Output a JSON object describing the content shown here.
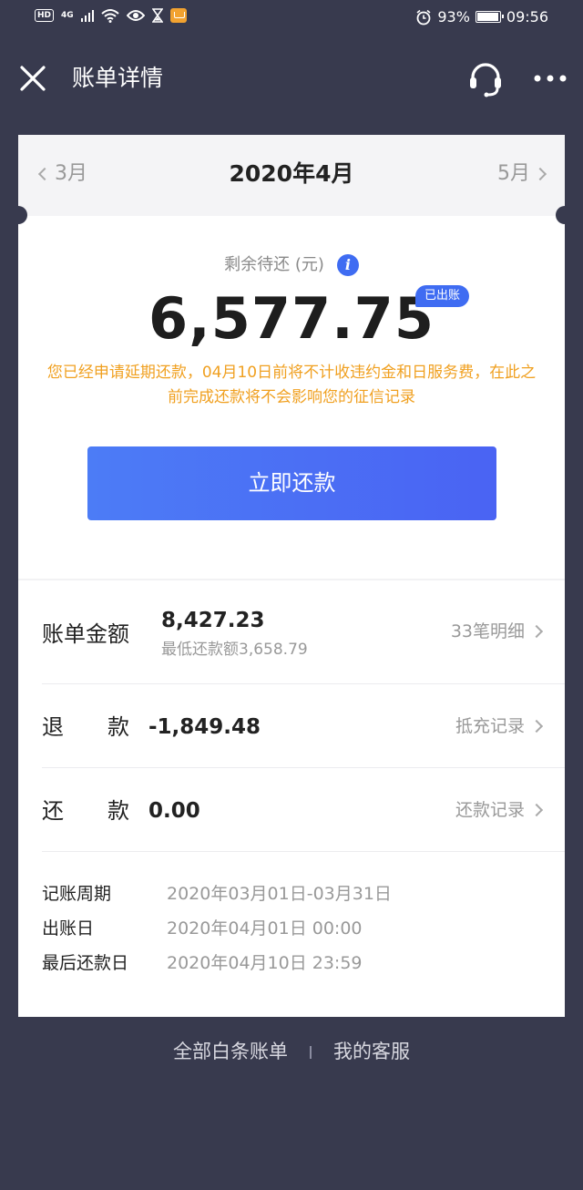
{
  "status_bar": {
    "hd": "HD",
    "network": "4G",
    "battery_percent": "93%",
    "time": "09:56"
  },
  "nav": {
    "title": "账单详情"
  },
  "month_bar": {
    "prev": "3月",
    "current": "2020年4月",
    "next": "5月"
  },
  "summary": {
    "remain_label": "剩余待还 (元)",
    "info_glyph": "i",
    "amount": "6,577.75",
    "badge": "已出账",
    "notice": "您已经申请延期还款，04月10日前将不计收违约金和日服务费，在此之前完成还款将不会影响您的征信记录",
    "pay_button": "立即还款"
  },
  "bill": {
    "label": "账单金额",
    "value": "8,427.23",
    "sub": "最低还款额3,658.79",
    "link": "33笔明细"
  },
  "refund": {
    "label": "退　　款",
    "value": "-1,849.48",
    "link": "抵充记录"
  },
  "repay": {
    "label": "还　　款",
    "value": "0.00",
    "link": "还款记录"
  },
  "info": [
    {
      "key": "记账周期",
      "value": "2020年03月01日-03月31日"
    },
    {
      "key": "出账日",
      "value": "2020年04月01日 00:00"
    },
    {
      "key": "最后还款日",
      "value": "2020年04月10日 23:59"
    }
  ],
  "footer": {
    "all_bills": "全部白条账单",
    "service": "我的客服"
  },
  "colors": {
    "background": "#383a4e",
    "accent": "#3f6cf2",
    "notice": "#f0a020"
  }
}
